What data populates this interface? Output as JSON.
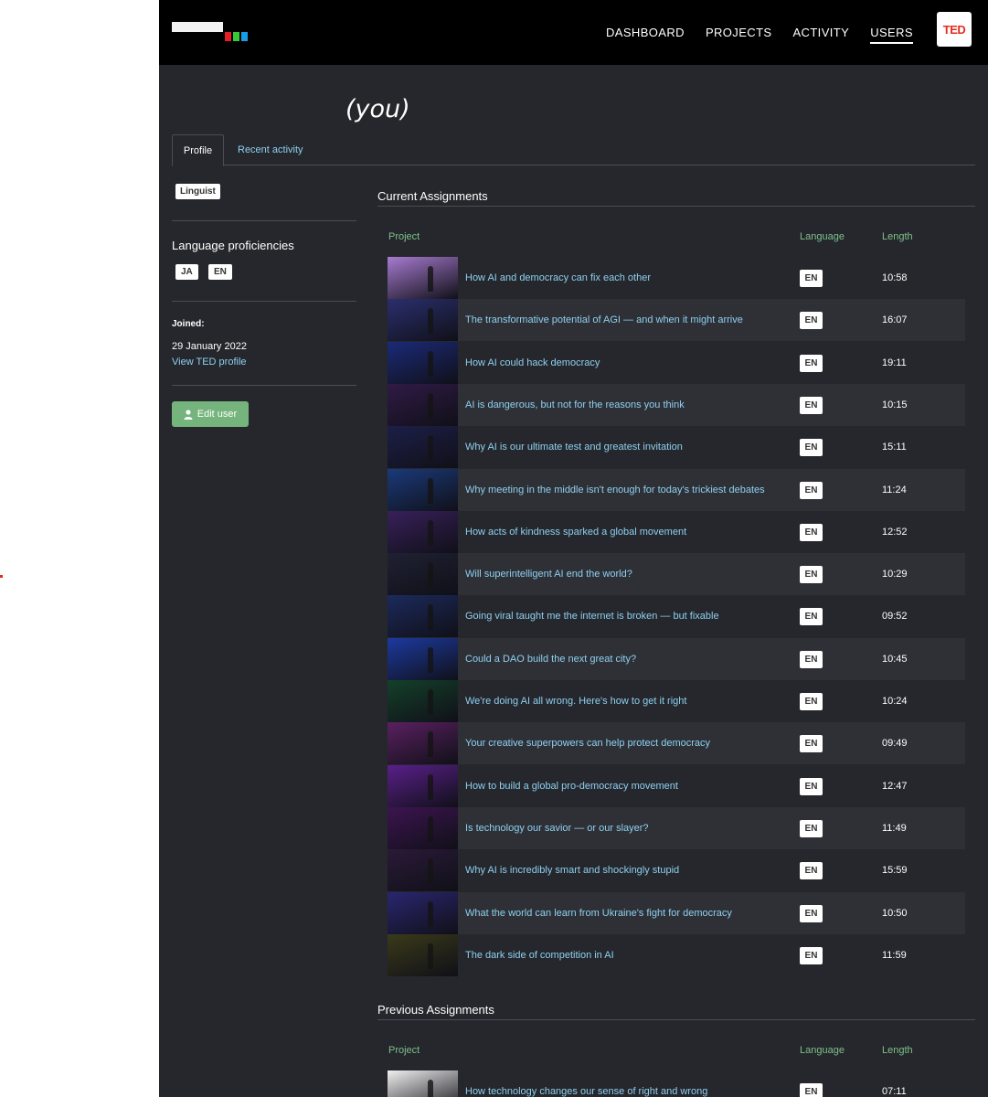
{
  "nav": {
    "items": [
      "DASHBOARD",
      "PROJECTS",
      "ACTIVITY",
      "USERS"
    ],
    "active": "USERS",
    "brand_badge": "TED",
    "logo_colors": [
      "#e41e26",
      "#37c837",
      "#1a9be6"
    ]
  },
  "profile": {
    "name_suffix": "(you)",
    "tabs": [
      "Profile",
      "Recent activity"
    ],
    "role": "Linguist",
    "language_heading": "Language proficiencies",
    "languages": [
      "JA",
      "EN"
    ],
    "joined_label": "Joined:",
    "joined_date": "29 January 2022",
    "profile_link": "View TED profile",
    "edit_button": "Edit user"
  },
  "columns": {
    "project": "Project",
    "language": "Language",
    "length": "Length"
  },
  "current": {
    "heading": "Current Assignments",
    "rows": [
      {
        "title": "How AI and democracy can fix each other",
        "lang": "EN",
        "length": "10:58",
        "thumb": "#a77bd0"
      },
      {
        "title": "The transformative potential of AGI — and when it might arrive",
        "lang": "EN",
        "length": "16:07",
        "thumb": "#2a2f6e"
      },
      {
        "title": "How AI could hack democracy",
        "lang": "EN",
        "length": "19:11",
        "thumb": "#1b2a78"
      },
      {
        "title": "AI is dangerous, but not for the reasons you think",
        "lang": "EN",
        "length": "10:15",
        "thumb": "#301a46"
      },
      {
        "title": "Why AI is our ultimate test and greatest invitation",
        "lang": "EN",
        "length": "15:11",
        "thumb": "#1c1f48"
      },
      {
        "title": "Why meeting in the middle isn't enough for today's trickiest debates",
        "lang": "EN",
        "length": "11:24",
        "thumb": "#1a3a7a"
      },
      {
        "title": "How acts of kindness sparked a global movement",
        "lang": "EN",
        "length": "12:52",
        "thumb": "#38205a"
      },
      {
        "title": "Will superintelligent AI end the world?",
        "lang": "EN",
        "length": "10:29",
        "thumb": "#1f2133"
      },
      {
        "title": "Going viral taught me the internet is broken — but fixable",
        "lang": "EN",
        "length": "09:52",
        "thumb": "#1c2a5c"
      },
      {
        "title": "Could a DAO build the next great city?",
        "lang": "EN",
        "length": "10:45",
        "thumb": "#1c3aa0"
      },
      {
        "title": "We're doing AI all wrong. Here's how to get it right",
        "lang": "EN",
        "length": "10:24",
        "thumb": "#14402a"
      },
      {
        "title": "Your creative superpowers can help protect democracy",
        "lang": "EN",
        "length": "09:49",
        "thumb": "#5a2060"
      },
      {
        "title": "How to build a global pro-democracy movement",
        "lang": "EN",
        "length": "12:47",
        "thumb": "#5a1f8a"
      },
      {
        "title": "Is technology our savior — or our slayer?",
        "lang": "EN",
        "length": "11:49",
        "thumb": "#3c1450"
      },
      {
        "title": "Why AI is incredibly smart and shockingly stupid",
        "lang": "EN",
        "length": "15:59",
        "thumb": "#2a1a38"
      },
      {
        "title": "What the world can learn from Ukraine's fight for democracy",
        "lang": "EN",
        "length": "10:50",
        "thumb": "#2a2670"
      },
      {
        "title": "The dark side of competition in AI",
        "lang": "EN",
        "length": "11:59",
        "thumb": "#3a3a1a"
      }
    ]
  },
  "previous": {
    "heading": "Previous Assignments",
    "rows": [
      {
        "title": "How technology changes our sense of right and wrong",
        "lang": "EN",
        "length": "07:11",
        "thumb": "#f0f0f0"
      }
    ]
  }
}
